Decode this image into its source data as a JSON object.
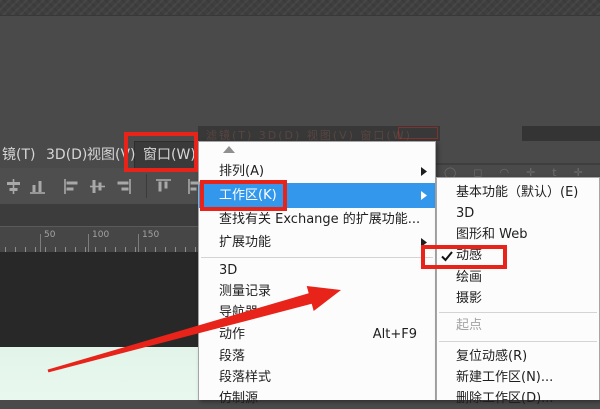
{
  "colors": {
    "accent_red": "#e8231a",
    "highlight_blue": "#3398ec",
    "canvas_mint": "#e5f5eb"
  },
  "menu_bar": {
    "items": [
      {
        "name": "filter",
        "label": "镜(T)"
      },
      {
        "name": "3d",
        "label": "3D(D)"
      },
      {
        "name": "view",
        "label": "视图(V)"
      },
      {
        "name": "window",
        "label": "窗口(W)",
        "active": true
      }
    ]
  },
  "dimmed_menu_strip": {
    "text": "滤镜(T)    3D(D)    视图(V)    窗口(W)"
  },
  "toolbar": {
    "icons": [
      "align-horizontal-centers-icon",
      "align-bottom-edges-icon",
      "align-left-edges-icon",
      "align-vertical-centers-icon",
      "align-right-edges-icon",
      "distribute-top-edges-icon",
      "distribute-left-edges-icon"
    ]
  },
  "ruler": {
    "labels": [
      "50",
      "100",
      "150"
    ]
  },
  "window_menu": {
    "scroll_up_icon": "scroll-up-arrow",
    "items": [
      {
        "name": "arrange",
        "label": "排列(A)",
        "submenu": true
      },
      {
        "name": "workspace",
        "label": "工作区(K)",
        "submenu": true,
        "selected": true
      },
      {
        "name": "find-extensions",
        "label": "查找有关 Exchange 的扩展功能..."
      },
      {
        "name": "extensions",
        "label": "扩展功能",
        "submenu": true
      },
      {
        "separator": true
      },
      {
        "name": "3d",
        "label": "3D"
      },
      {
        "name": "measurement-log",
        "label": "测量记录"
      },
      {
        "name": "navigator",
        "label": "导航器"
      },
      {
        "name": "actions",
        "label": "动作",
        "shortcut": "Alt+F9"
      },
      {
        "name": "paragraph",
        "label": "段落"
      },
      {
        "name": "paragraph-styles",
        "label": "段落样式"
      },
      {
        "name": "clone-source",
        "label": "仿制源"
      }
    ]
  },
  "workspace_submenu": {
    "items": [
      {
        "name": "essentials",
        "label": "基本功能（默认）(E)"
      },
      {
        "name": "3d",
        "label": "3D"
      },
      {
        "name": "graphics-web",
        "label": "图形和 Web"
      },
      {
        "name": "motion",
        "label": "动感",
        "checked": true
      },
      {
        "name": "painting",
        "label": "绘画"
      },
      {
        "name": "photography",
        "label": "摄影"
      },
      {
        "separator": true
      },
      {
        "name": "start",
        "label": "起点",
        "disabled": true
      },
      {
        "separator": true,
        "tall": true
      },
      {
        "name": "reset-motion",
        "label": "复位动感(R)"
      },
      {
        "name": "new-workspace",
        "label": "新建工作区(N)..."
      },
      {
        "name": "delete-workspace",
        "label": "删除工作区(D)..."
      }
    ]
  }
}
